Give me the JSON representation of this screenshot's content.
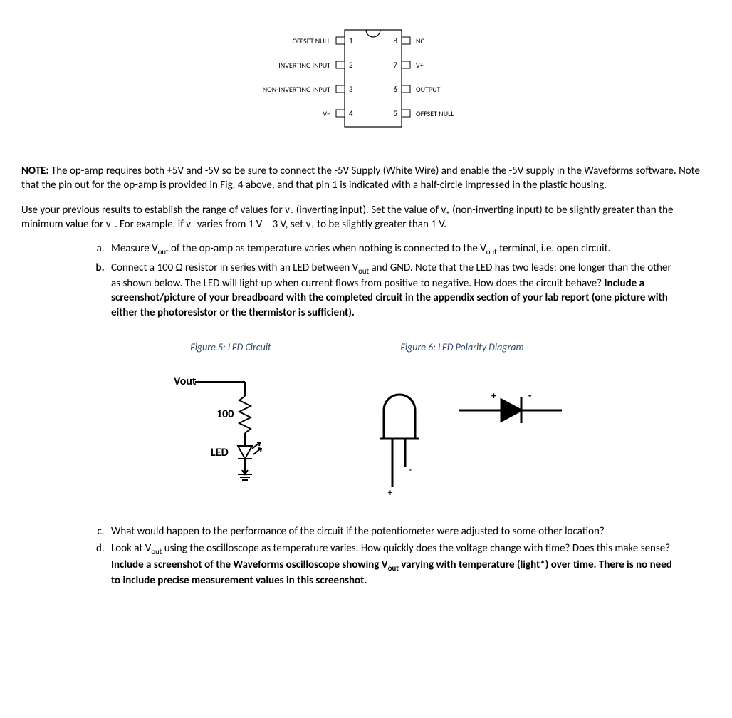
{
  "ic": {
    "left": [
      {
        "label": "OFFSET NULL",
        "num": "1"
      },
      {
        "label": "INVERTING INPUT",
        "num": "2"
      },
      {
        "label": "NON-INVERTING INPUT",
        "num": "3"
      },
      {
        "label": "V−",
        "num": "4"
      }
    ],
    "right": [
      {
        "label": "NC",
        "num": "8"
      },
      {
        "label": "V+",
        "num": "7"
      },
      {
        "label": "OUTPUT",
        "num": "6"
      },
      {
        "label": "OFFSET NULL",
        "num": "5"
      }
    ]
  },
  "note": {
    "prefix": "NOTE:",
    "body": " The op-amp requires both +5V and -5V so be sure to connect the -5V Supply (White Wire) and enable the -5V supply in the Waveforms software.  Note that the pin out for the op-amp is provided in Fig. 4 above, and that pin 1 is indicated with a half-circle impressed in the plastic housing."
  },
  "para2": "Use your previous results to establish the range of values for v₋ (inverting input). Set the value of v₊ (non-inverting input) to be slightly greater than the minimum value for v₋.  For example, if v₋ varies from 1 V – 3 V, set v₊ to be slightly greater than 1 V.",
  "items": {
    "a": {
      "t1": "Measure V",
      "sub1": "out",
      "t2": " of the op-amp as temperature varies when nothing is connected to the V",
      "sub2": "out",
      "t3": " terminal, i.e. open circuit."
    },
    "b": {
      "t1": "Connect a 100 Ω resistor in series with an LED between V",
      "sub1": "out",
      "t2": " and GND.  Note that the LED has two leads; one longer than the other as shown below.  The LED will light up when current flows from positive to negative. How does the circuit behave?  ",
      "bold": "Include a screenshot/picture of your breadboard with the completed circuit in the appendix section of your lab report (one picture with either the photoresistor or the thermistor is sufficient)."
    },
    "c": "What would happen to the performance of the circuit if the potentiometer were adjusted to some other location?",
    "d": {
      "t1": "Look at V",
      "sub1": "out",
      "t2": " using the oscilloscope as temperature varies.  How quickly does the voltage change with time? Does this make sense? ",
      "bold1": "Include a screenshot of the Waveforms oscilloscope showing V",
      "boldsub": "out",
      "bold2": " varying with temperature (light*) over time. There is no need to include precise measurement values in this screenshot."
    }
  },
  "fig5": {
    "caption": "Figure 5: LED Circuit",
    "vout": "Vout",
    "r": "100",
    "led": "LED"
  },
  "fig6": {
    "caption": "Figure 6: LED Polarity Diagram",
    "plus": "+",
    "minus": "-"
  }
}
